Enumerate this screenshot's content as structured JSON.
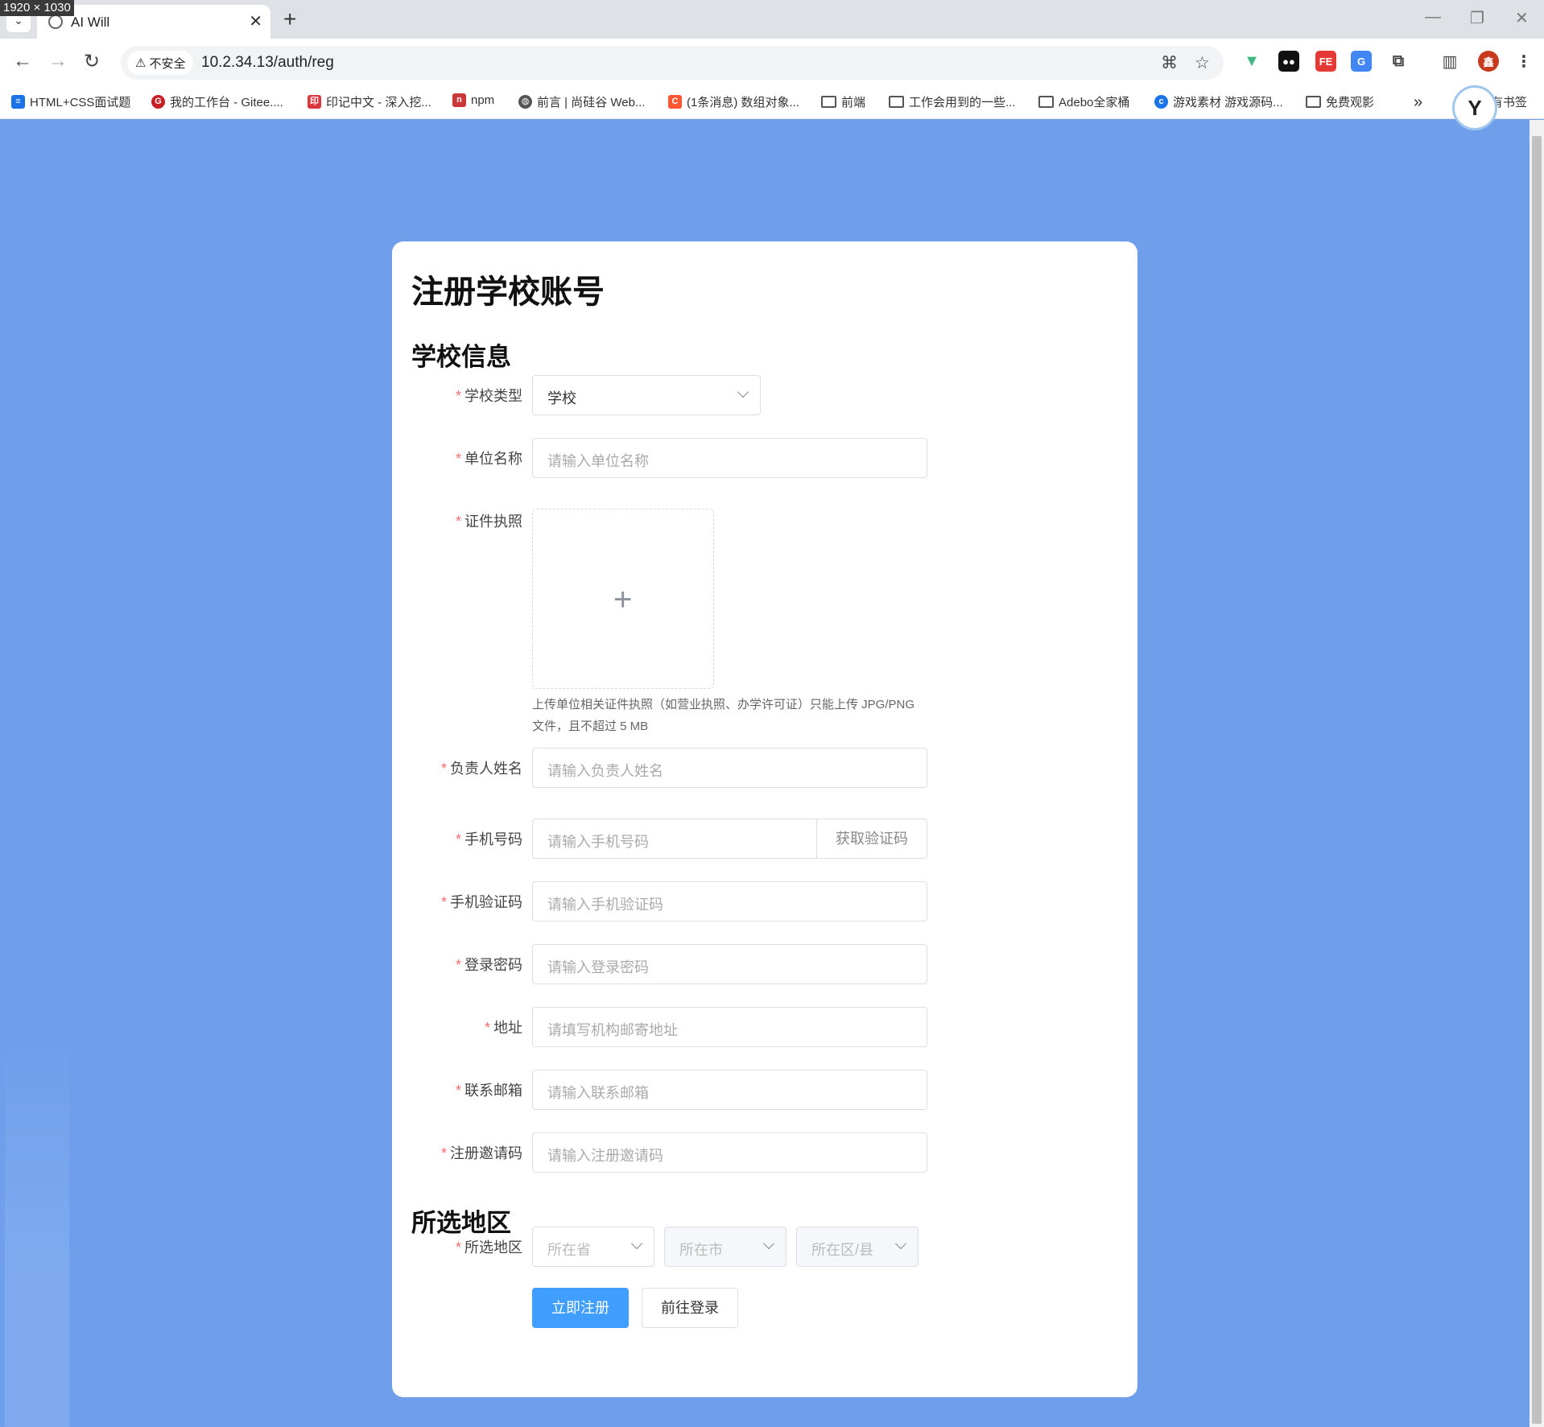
{
  "screen_badge": "1920 × 1030",
  "browser": {
    "tab_title": "AI Will",
    "tab_close": "✕",
    "new_tab": "+",
    "url": "10.2.34.13/auth/reg",
    "security_label": "不安全",
    "bookmarks": [
      {
        "label": "HTML+CSS面试题",
        "icon": "doc-icon",
        "color": "#1a73e8"
      },
      {
        "label": "我的工作台 - Gitee....",
        "icon": "gitee-icon",
        "color": "#c71d23"
      },
      {
        "label": "印记中文 - 深入挖...",
        "icon": "yinji-icon",
        "color": "#d9363e"
      },
      {
        "label": "npm",
        "icon": "npm-icon",
        "color": "#cb3837"
      },
      {
        "label": "前言 | 尚硅谷 Web...",
        "icon": "globe-icon",
        "color": "#555555"
      },
      {
        "label": "(1条消息) 数组对象...",
        "icon": "csdn-icon",
        "color": "#fc5531"
      },
      {
        "label": "前端",
        "icon": "folder-icon"
      },
      {
        "label": "工作会用到的一些...",
        "icon": "folder-icon"
      },
      {
        "label": "Adebo全家桶",
        "icon": "folder-icon"
      },
      {
        "label": "游戏素材 游戏源码...",
        "icon": "game-icon",
        "color": "#1a73e8"
      },
      {
        "label": "免费观影",
        "icon": "folder-icon"
      }
    ],
    "bookmarks_more": "»",
    "all_bookmarks_label": "所有书签"
  },
  "form": {
    "page_title": "注册学校账号",
    "section_school": "学校信息",
    "section_region": "所选地区",
    "required_mark": "*",
    "school_type": {
      "label": "学校类型",
      "value": "学校"
    },
    "unit_name": {
      "label": "单位名称",
      "placeholder": "请输入单位名称"
    },
    "license": {
      "label": "证件执照",
      "hint": "上传单位相关证件执照（如营业执照、办学许可证）只能上传 JPG/PNG 文件，且不超过 5 MB"
    },
    "principal_name": {
      "label": "负责人姓名",
      "placeholder": "请输入负责人姓名"
    },
    "phone": {
      "label": "手机号码",
      "placeholder": "请输入手机号码",
      "verify_button": "获取验证码"
    },
    "phone_code": {
      "label": "手机验证码",
      "placeholder": "请输入手机验证码"
    },
    "password": {
      "label": "登录密码",
      "placeholder": "请输入登录密码"
    },
    "address": {
      "label": "地址",
      "placeholder": "请填写机构邮寄地址"
    },
    "email": {
      "label": "联系邮箱",
      "placeholder": "请输入联系邮箱"
    },
    "invite_code": {
      "label": "注册邀请码",
      "placeholder": "请输入注册邀请码"
    },
    "region": {
      "label": "所选地区",
      "province_placeholder": "所在省",
      "city_placeholder": "所在市",
      "district_placeholder": "所在区/县"
    },
    "register_button": "立即注册",
    "login_button": "前往登录"
  },
  "colors": {
    "page_background": "#6f9feb",
    "primary": "#409eff",
    "required": "#f56c6c"
  }
}
